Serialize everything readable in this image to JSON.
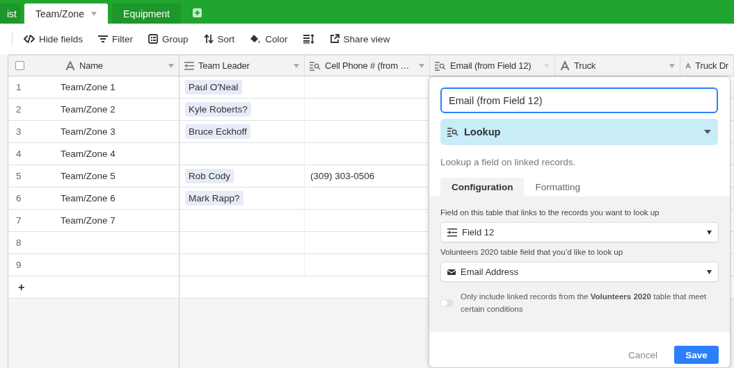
{
  "table_tabs": [
    {
      "label": "ist",
      "selected": false
    },
    {
      "label": "Team/Zone",
      "selected": true
    },
    {
      "label": "Equipment",
      "selected": false
    }
  ],
  "toolbar": [
    {
      "kind": "hide",
      "label": "Hide fields"
    },
    {
      "kind": "filter",
      "label": "Filter"
    },
    {
      "kind": "group",
      "label": "Group"
    },
    {
      "kind": "sort",
      "label": "Sort"
    },
    {
      "kind": "color",
      "label": "Color"
    },
    {
      "kind": "height"
    },
    {
      "kind": "share",
      "label": "Share view"
    }
  ],
  "grid": {
    "select_all": {
      "checked": false
    },
    "columns": [
      {
        "kind": "text",
        "label": "Name"
      },
      {
        "kind": "link",
        "label": "Team Leader"
      },
      {
        "kind": "lookup",
        "label": "Cell Phone # (from …"
      },
      {
        "kind": "lookup",
        "label": "Email (from Field 12)"
      },
      {
        "kind": "text",
        "label": "Truck"
      },
      {
        "kind": "text",
        "label": "Truck Dr"
      }
    ],
    "rows": [
      {
        "number": "1",
        "name": "Team/Zone 1",
        "team_leader": "Paul O'Neal"
      },
      {
        "number": "2",
        "name": "Team/Zone 2",
        "team_leader": "Kyle Roberts?"
      },
      {
        "number": "3",
        "name": "Team/Zone 3",
        "team_leader": "Bruce Eckhoff"
      },
      {
        "number": "4",
        "name": "Team/Zone 4"
      },
      {
        "number": "5",
        "name": "Team/Zone 5",
        "team_leader": "Rob Cody",
        "cell_phone": "(309) 303-0506"
      },
      {
        "number": "6",
        "name": "Team/Zone 6",
        "team_leader": "Mark Rapp?"
      },
      {
        "number": "7",
        "name": "Team/Zone 7"
      },
      {
        "number": "8"
      },
      {
        "number": "9"
      }
    ],
    "add_row": "+"
  },
  "field_editor": {
    "name": "Email (from Field 12)",
    "type": "Lookup",
    "description": "Lookup a field on linked records.",
    "tabs": [
      {
        "label": "Configuration",
        "selected": true
      },
      {
        "label": "Formatting",
        "selected": false
      }
    ],
    "link_label": "Field on this table that links to the records you want to look up",
    "link_field": "Field 12",
    "lookup_label": "Volunteers 2020 table field that you’d like to look up",
    "lookup_field": "Email Address",
    "condition_toggle": {
      "on": false,
      "label": "Only include linked records from the **Volunteers 2020** table that meet certain conditions"
    },
    "cancel": "Cancel",
    "save": "Save"
  }
}
